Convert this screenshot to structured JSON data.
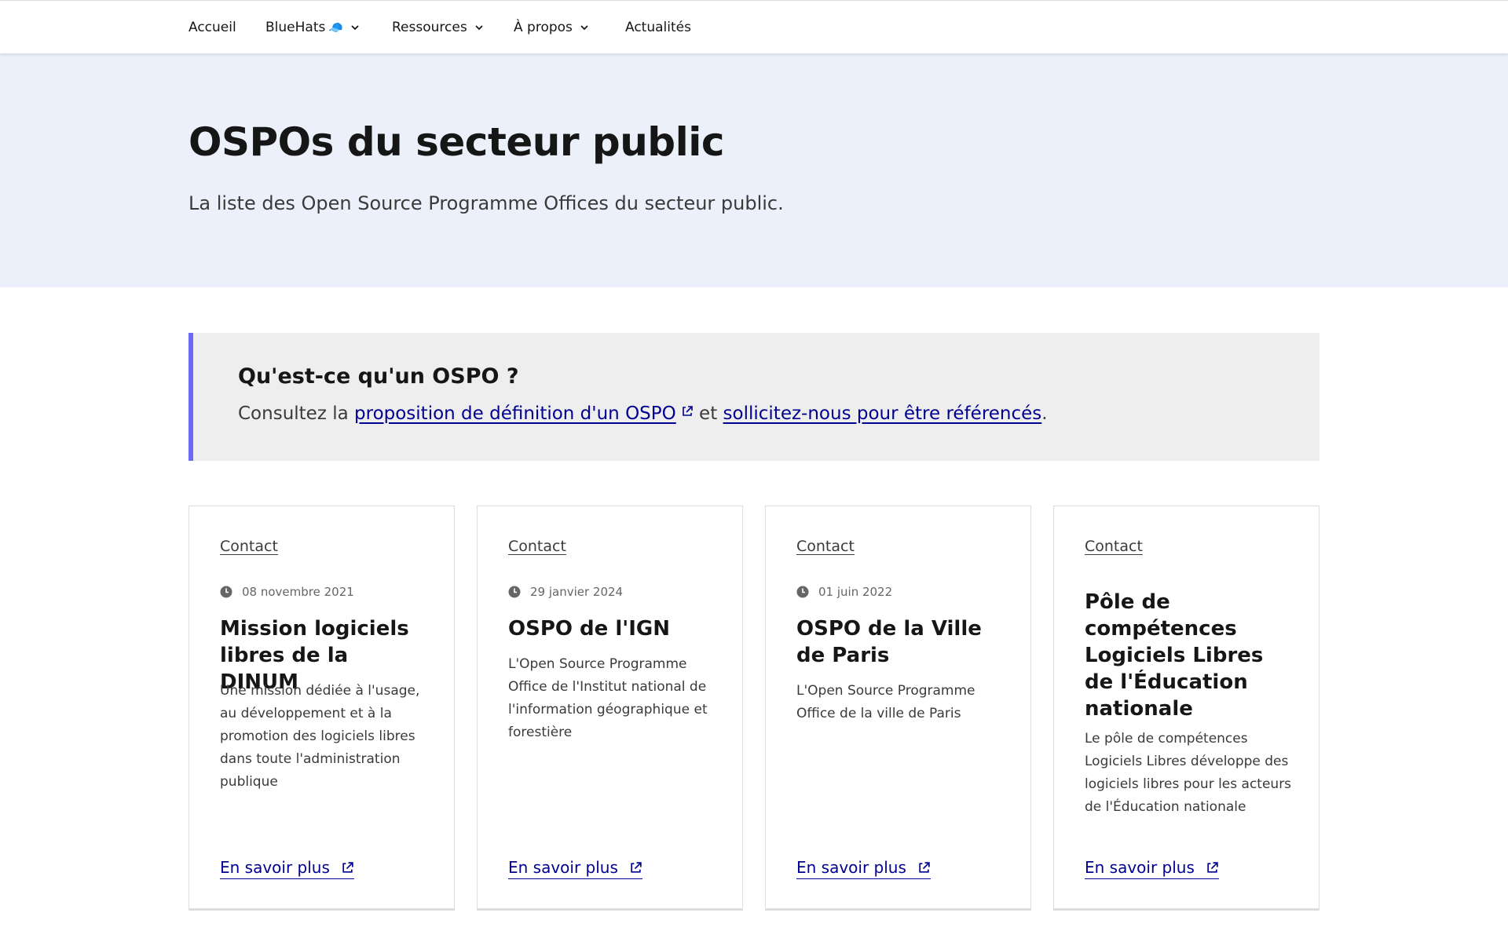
{
  "nav": {
    "items": [
      {
        "label": "Accueil",
        "has_dropdown": false
      },
      {
        "label": "BlueHats",
        "emoji": "🧢",
        "has_dropdown": true
      },
      {
        "label": "Ressources",
        "has_dropdown": true
      },
      {
        "label": "À propos",
        "has_dropdown": true
      },
      {
        "label": "Actualités",
        "has_dropdown": false
      }
    ]
  },
  "hero": {
    "title": "OSPOs du secteur public",
    "subtitle": "La liste des Open Source Programme Offices du secteur public."
  },
  "callout": {
    "title": "Qu'est-ce qu'un OSPO ?",
    "text_prefix": "Consultez la ",
    "link1": "proposition de définition d'un OSPO",
    "text_middle": " et ",
    "link2": "sollicitez-nous pour être référencés",
    "text_suffix": ".",
    "accent_color": "#6a6af4"
  },
  "cards": [
    {
      "tag": "Contact",
      "date": "08 novembre 2021",
      "title": "Mission logiciels libres de la DINUM",
      "description": "Une mission dédiée à l'usage, au développement et à la promotion des logiciels libres dans toute l'administration publique",
      "link": "En savoir plus"
    },
    {
      "tag": "Contact",
      "date": "29 janvier 2024",
      "title": "OSPO de l'IGN",
      "description": "L'Open Source Programme Office de l'Institut national de l'information géographique et forestière",
      "link": "En savoir plus"
    },
    {
      "tag": "Contact",
      "date": "01 juin 2022",
      "title": "OSPO de la Ville de Paris",
      "description": "L'Open Source Programme Office de la ville de Paris",
      "link": "En savoir plus"
    },
    {
      "tag": "Contact",
      "date": "",
      "title": "Pôle de compétences Logiciels Libres de l'Éducation nationale",
      "description": "Le pôle de compétences Logiciels Libres développe des logiciels libres pour les acteurs de l'Éducation nationale",
      "link": "En savoir plus"
    }
  ],
  "colors": {
    "link": "#000091",
    "hero_bg": "#ecf0fa",
    "callout_bg": "#eeeeee"
  },
  "icons": {
    "clock": "clock-icon",
    "external": "external-link-icon",
    "chevron": "chevron-down-icon"
  }
}
